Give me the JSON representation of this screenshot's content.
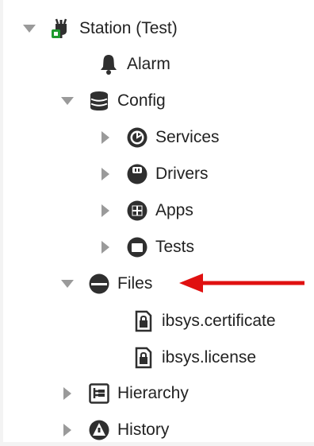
{
  "tree": {
    "station": {
      "label": "Station (Test)",
      "icon": "station-plug-icon",
      "expanded": true
    },
    "alarm": {
      "label": "Alarm",
      "icon": "bell-icon"
    },
    "config": {
      "label": "Config",
      "icon": "database-icon",
      "expanded": true
    },
    "services": {
      "label": "Services",
      "icon": "services-icon",
      "expanded": false
    },
    "drivers": {
      "label": "Drivers",
      "icon": "drivers-icon",
      "expanded": false
    },
    "apps": {
      "label": "Apps",
      "icon": "apps-grid-icon",
      "expanded": false
    },
    "tests": {
      "label": "Tests",
      "icon": "tests-window-icon",
      "expanded": false
    },
    "files": {
      "label": "Files",
      "icon": "files-drive-icon",
      "expanded": true
    },
    "certificate": {
      "label": "ibsys.certificate",
      "icon": "locked-file-icon"
    },
    "license": {
      "label": "ibsys.license",
      "icon": "locked-file-icon"
    },
    "hierarchy": {
      "label": "Hierarchy",
      "icon": "hierarchy-icon",
      "expanded": false
    },
    "history": {
      "label": "History",
      "icon": "history-icon",
      "expanded": false
    }
  },
  "colors": {
    "icon": "#2f2f2f",
    "toggle": "#9a9a9a",
    "annotation_arrow": "#e01010",
    "station_green": "#1e9a2e"
  }
}
